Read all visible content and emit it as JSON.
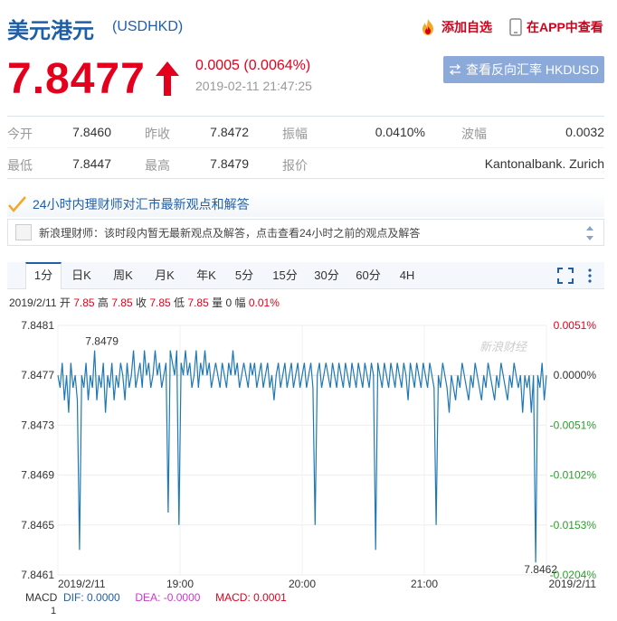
{
  "header": {
    "title": "美元港元",
    "code": "(USDHKD)",
    "add_watch": "添加自选",
    "view_app": "在APP中查看"
  },
  "quote": {
    "price": "7.8477",
    "change": "0.0005 (0.0064%)",
    "timestamp": "2019-02-11 21:47:25",
    "reverse_button": "查看反向汇率 HKDUSD"
  },
  "stats": [
    [
      {
        "label": "今开",
        "value": "7.8460"
      },
      {
        "label": "昨收",
        "value": "7.8472"
      },
      {
        "label": "振幅",
        "value": "0.0410%"
      },
      {
        "label": "波幅",
        "value": "0.0032"
      }
    ],
    [
      {
        "label": "最低",
        "value": "7.8447"
      },
      {
        "label": "最高",
        "value": "7.8479"
      },
      {
        "label": "报价",
        "value": "Kantonalbank. Zurich"
      }
    ]
  ],
  "opinion": {
    "title": "24小时内理财师对汇市最新观点和解答",
    "message": "新浪理财师：该时段内暂无最新观点及解答，点击查看24小时之前的观点及解答"
  },
  "tabs": [
    "1分",
    "日K",
    "周K",
    "月K",
    "年K",
    "5分",
    "15分",
    "30分",
    "60分",
    "4H"
  ],
  "active_tab": "1分",
  "ohlc": {
    "date": "2019/2/11",
    "open_label": "开",
    "open": "7.85",
    "high_label": "高",
    "high": "7.85",
    "close_label": "收",
    "close": "7.85",
    "low_label": "低",
    "low": "7.85",
    "vol_label": "量",
    "vol": "0",
    "amp_label": "幅",
    "amp": "0.01%"
  },
  "chart_data": {
    "type": "line",
    "y_ticks": [
      "7.8481",
      "7.8477",
      "7.8473",
      "7.8469",
      "7.8465",
      "7.8461"
    ],
    "pct_ticks": [
      "0.0051%",
      "0.0000%",
      "-0.0051%",
      "-0.0102%",
      "-0.0153%",
      "-0.0204%"
    ],
    "x_ticks": [
      "2019/2/11",
      "19:00",
      "20:00",
      "21:00",
      "2019/2/11"
    ],
    "ylim": [
      7.8461,
      7.8481
    ],
    "max_label": "7.8479",
    "min_label": "7.8462",
    "watermark": "新浪财经",
    "base_value": 7.8477,
    "series_color": "#1f78b4",
    "values": [
      7.8477,
      7.8476,
      7.8478,
      7.8475,
      7.8477,
      7.8474,
      7.8478,
      7.8476,
      7.8477,
      7.8475,
      7.8463,
      7.8477,
      7.8476,
      7.8478,
      7.8475,
      7.8477,
      7.8476,
      7.8479,
      7.8475,
      7.8477,
      7.8476,
      7.8478,
      7.8474,
      7.8477,
      7.8476,
      7.8478,
      7.8475,
      7.8477,
      7.8476,
      7.8478,
      7.8477,
      7.8475,
      7.8478,
      7.8476,
      7.8477,
      7.8479,
      7.8476,
      7.8477,
      7.8478,
      7.8476,
      7.8479,
      7.8477,
      7.8478,
      7.8476,
      7.8477,
      7.8479,
      7.8477,
      7.8478,
      7.8476,
      7.8477,
      7.8478,
      7.8466,
      7.8479,
      7.8478,
      7.8477,
      7.8479,
      7.8465,
      7.8478,
      7.8477,
      7.8479,
      7.8477,
      7.8478,
      7.8476,
      7.8477,
      7.8479,
      7.8476,
      7.8478,
      7.8477,
      7.8479,
      7.8477,
      7.8478,
      7.8476,
      7.8477,
      7.8478,
      7.8477,
      7.8476,
      7.8478,
      7.8477,
      7.8476,
      7.8478,
      7.8477,
      7.8479,
      7.8477,
      7.8478,
      7.8476,
      7.8477,
      7.8478,
      7.8477,
      7.8476,
      7.8478,
      7.8477,
      7.8478,
      7.8476,
      7.8477,
      7.8478,
      7.8476,
      7.8477,
      7.8478,
      7.8476,
      7.8477,
      7.8475,
      7.8477,
      7.8478,
      7.8476,
      7.8477,
      7.8478,
      7.8476,
      7.8477,
      7.8478,
      7.8476,
      7.8477,
      7.8478,
      7.8476,
      7.8477,
      7.8478,
      7.8476,
      7.8477,
      7.8478,
      7.8476,
      7.8465,
      7.8477,
      7.8478,
      7.8476,
      7.8477,
      7.8478,
      7.8477,
      7.8476,
      7.8478,
      7.8477,
      7.8476,
      7.8478,
      7.8477,
      7.8476,
      7.8478,
      7.8477,
      7.8476,
      7.8478,
      7.8477,
      7.8476,
      7.8478,
      7.8477,
      7.8476,
      7.8478,
      7.8477,
      7.8476,
      7.8478,
      7.8477,
      7.8463,
      7.8478,
      7.8477,
      7.8476,
      7.8478,
      7.8477,
      7.8476,
      7.8478,
      7.8477,
      7.8476,
      7.8478,
      7.8477,
      7.8476,
      7.8478,
      7.8477,
      7.8475,
      7.8478,
      7.8477,
      7.8476,
      7.8478,
      7.8477,
      7.8476,
      7.8478,
      7.8477,
      7.8476,
      7.8478,
      7.8477,
      7.8476,
      7.8465,
      7.8477,
      7.8476,
      7.8478,
      7.8477,
      7.8476,
      7.8474,
      7.8477,
      7.8476,
      7.8475,
      7.8477,
      7.8476,
      7.8478,
      7.8477,
      7.8476,
      7.8475,
      7.8477,
      7.8476,
      7.8478,
      7.8477,
      7.8476,
      7.8475,
      7.8477,
      7.8476,
      7.8478,
      7.8477,
      7.8476,
      7.8475,
      7.8477,
      7.8476,
      7.8478,
      7.8477,
      7.8476,
      7.8475,
      7.8477,
      7.8476,
      7.8478,
      7.8477,
      7.8476,
      7.8477,
      7.8474,
      7.8477,
      7.8476,
      7.8477,
      7.8474,
      7.8477,
      7.8462,
      7.8477,
      7.8476,
      7.8478,
      7.8475,
      7.8477
    ]
  },
  "macd": {
    "label": "MACD",
    "dif": "DIF: 0.0000",
    "dea": "DEA: -0.0000",
    "macd": "MACD: 0.0001",
    "axis_tick": "1"
  }
}
